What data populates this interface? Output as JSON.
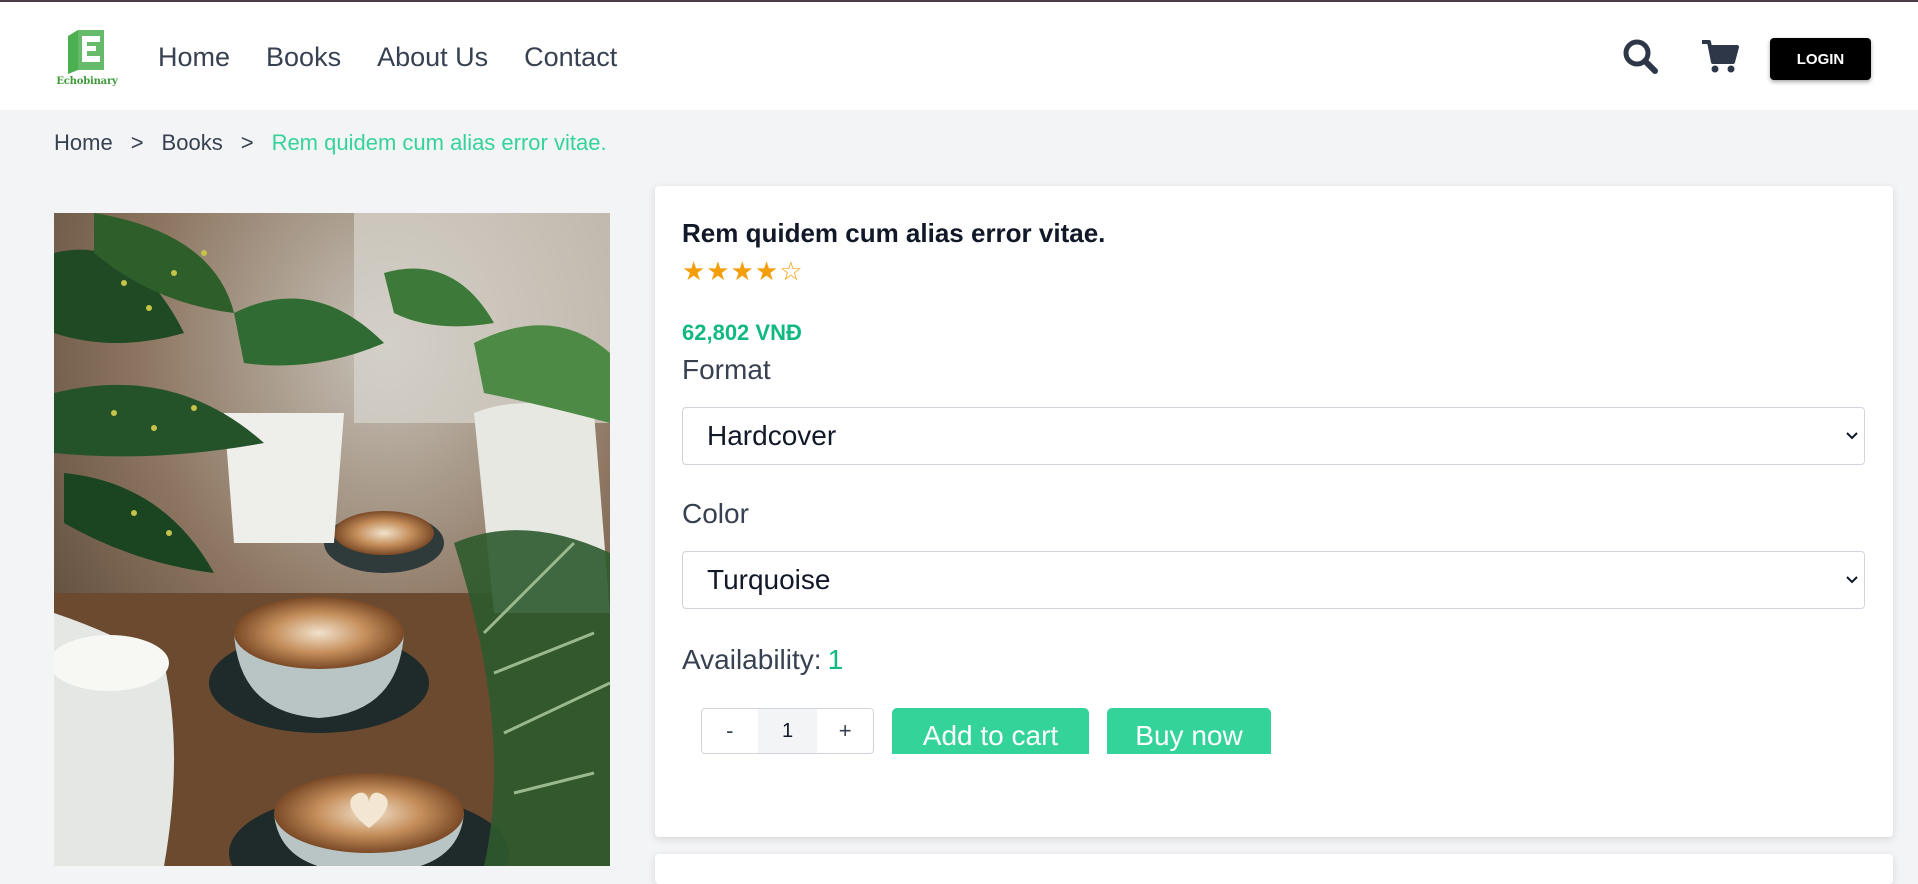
{
  "brand": {
    "name": "Echobinary",
    "color": "#5cb85c"
  },
  "nav": {
    "items": [
      {
        "label": "Home"
      },
      {
        "label": "Books"
      },
      {
        "label": "About Us"
      },
      {
        "label": "Contact"
      }
    ]
  },
  "header": {
    "login_label": "LOGIN",
    "search_icon": "search-icon",
    "cart_icon": "cart-icon"
  },
  "breadcrumb": {
    "items": [
      "Home",
      "Books"
    ],
    "separator": ">",
    "current": "Rem quidem cum alias error vitae."
  },
  "product": {
    "title": "Rem quidem cum alias error vitae.",
    "rating_stars": "★★★★☆",
    "rating": 4,
    "rating_max": 5,
    "price": "62,802 VNĐ",
    "format_label": "Format",
    "format_value": "Hardcover",
    "color_label": "Color",
    "color_value": "Turquoise",
    "availability_label": "Availability:",
    "availability_value": "1",
    "quantity": "1",
    "minus": "-",
    "plus": "+",
    "add_to_cart": "Add to cart",
    "buy_now": "Buy now"
  },
  "colors": {
    "accent": "#34d399",
    "price": "#10b981",
    "star": "#f59e0b"
  }
}
